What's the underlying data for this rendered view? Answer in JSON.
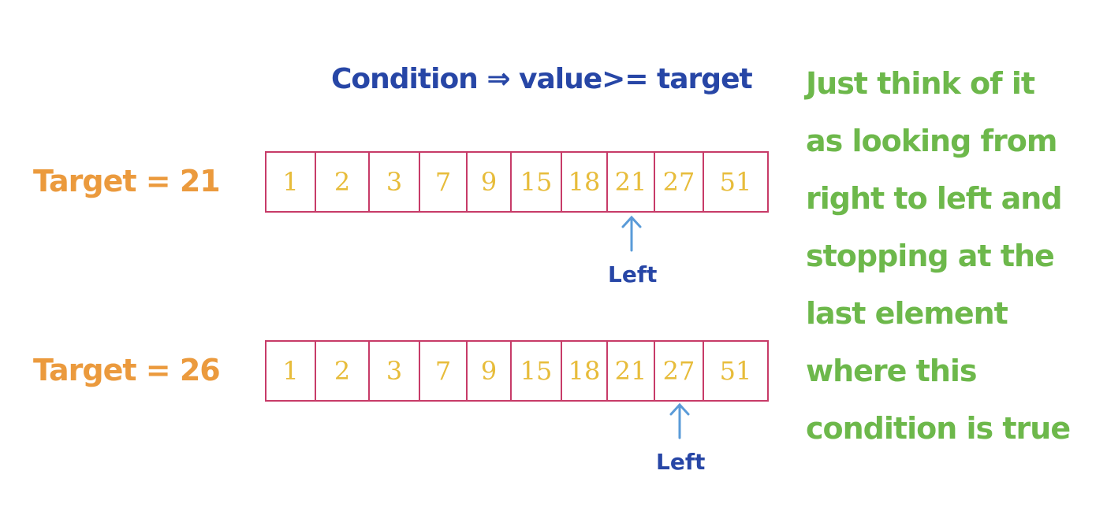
{
  "condition": "Condition ⇒ value>= target",
  "diagrams": [
    {
      "target_label": "Target = 21",
      "values": [
        "1",
        "2",
        "3",
        "7",
        "9",
        "15",
        "18",
        "21",
        "27",
        "51"
      ],
      "pointer_index": 7,
      "pointer_label": "Left"
    },
    {
      "target_label": "Target = 26",
      "values": [
        "1",
        "2",
        "3",
        "7",
        "9",
        "15",
        "18",
        "21",
        "27",
        "51"
      ],
      "pointer_index": 8,
      "pointer_label": "Left"
    }
  ],
  "note_lines": [
    "Just think of it",
    "as looking from",
    "right to left and",
    "stopping at the",
    "last element",
    "where this",
    "condition is true"
  ],
  "colors": {
    "condition": "#2746a6",
    "target": "#eb9a3d",
    "cell_border": "#c73b68",
    "cell_text": "#e7bc3a",
    "pointer": "#5a9bd8",
    "note": "#6db84b"
  }
}
